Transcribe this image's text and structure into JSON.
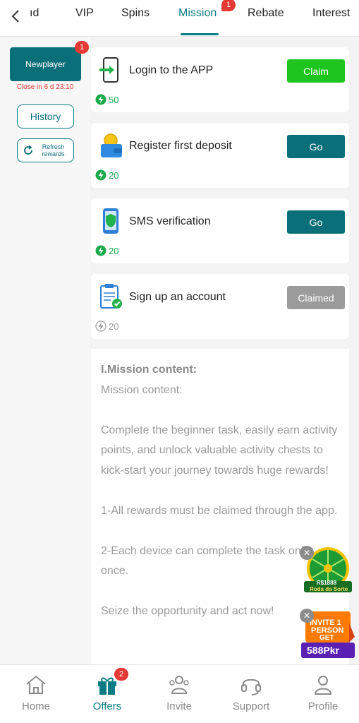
{
  "tabs": [
    {
      "label": "ıd"
    },
    {
      "label": "VIP"
    },
    {
      "label": "Spins"
    },
    {
      "label": "Mission",
      "badge": "1",
      "active": true
    },
    {
      "label": "Rebate"
    },
    {
      "label": "Interest"
    }
  ],
  "sidebar": {
    "newplayer_label": "Newplayer",
    "newplayer_badge": "1",
    "close_in": "Close in 6 d 23:10",
    "history_label": "History",
    "refresh_label": "Refresh rewards"
  },
  "tasks": [
    {
      "title": "Login to the APP",
      "button": "Claim",
      "points": "50",
      "icon": "phone-login-icon"
    },
    {
      "title": "Register first deposit",
      "button": "Go",
      "points": "20",
      "icon": "wallet-coin-icon"
    },
    {
      "title": "SMS verification",
      "button": "Go",
      "points": "20",
      "icon": "phone-shield-icon"
    },
    {
      "title": "Sign up an account",
      "button": "Claimed",
      "points": "20",
      "icon": "clipboard-check-icon"
    }
  ],
  "content": {
    "heading": "I.Mission content:",
    "subheading": "Mission content:",
    "para1": "Complete the beginner task, easily earn activity points, and unlock valuable activity chests to kick-start your journey towards huge rewards!",
    "para2": "1-All rewards must be claimed through the app.",
    "para3": "2-Each device can complete the task only once.",
    "para4": "Seize the opportunity and act now!"
  },
  "promos": {
    "wheel_amount": "R$1888",
    "wheel_label": "Roda da Sorte",
    "invite_line1": "INVITE 1",
    "invite_line2": "PERSON",
    "invite_get": "GET",
    "invite_amount": "588Pkr"
  },
  "bottom_nav": [
    {
      "label": "Home",
      "icon": "home-icon"
    },
    {
      "label": "Offers",
      "icon": "gift-icon",
      "badge": "2",
      "active": true
    },
    {
      "label": "Invite",
      "icon": "invite-icon"
    },
    {
      "label": "Support",
      "icon": "headset-icon"
    },
    {
      "label": "Profile",
      "icon": "profile-icon"
    }
  ],
  "colors": {
    "accent": "#0b7b84",
    "claim_green": "#1fc51f",
    "go_teal": "#0b6f7a",
    "claimed_grey": "#9b9b9b",
    "badge_red": "#e53935",
    "points_green": "#19a84a"
  }
}
